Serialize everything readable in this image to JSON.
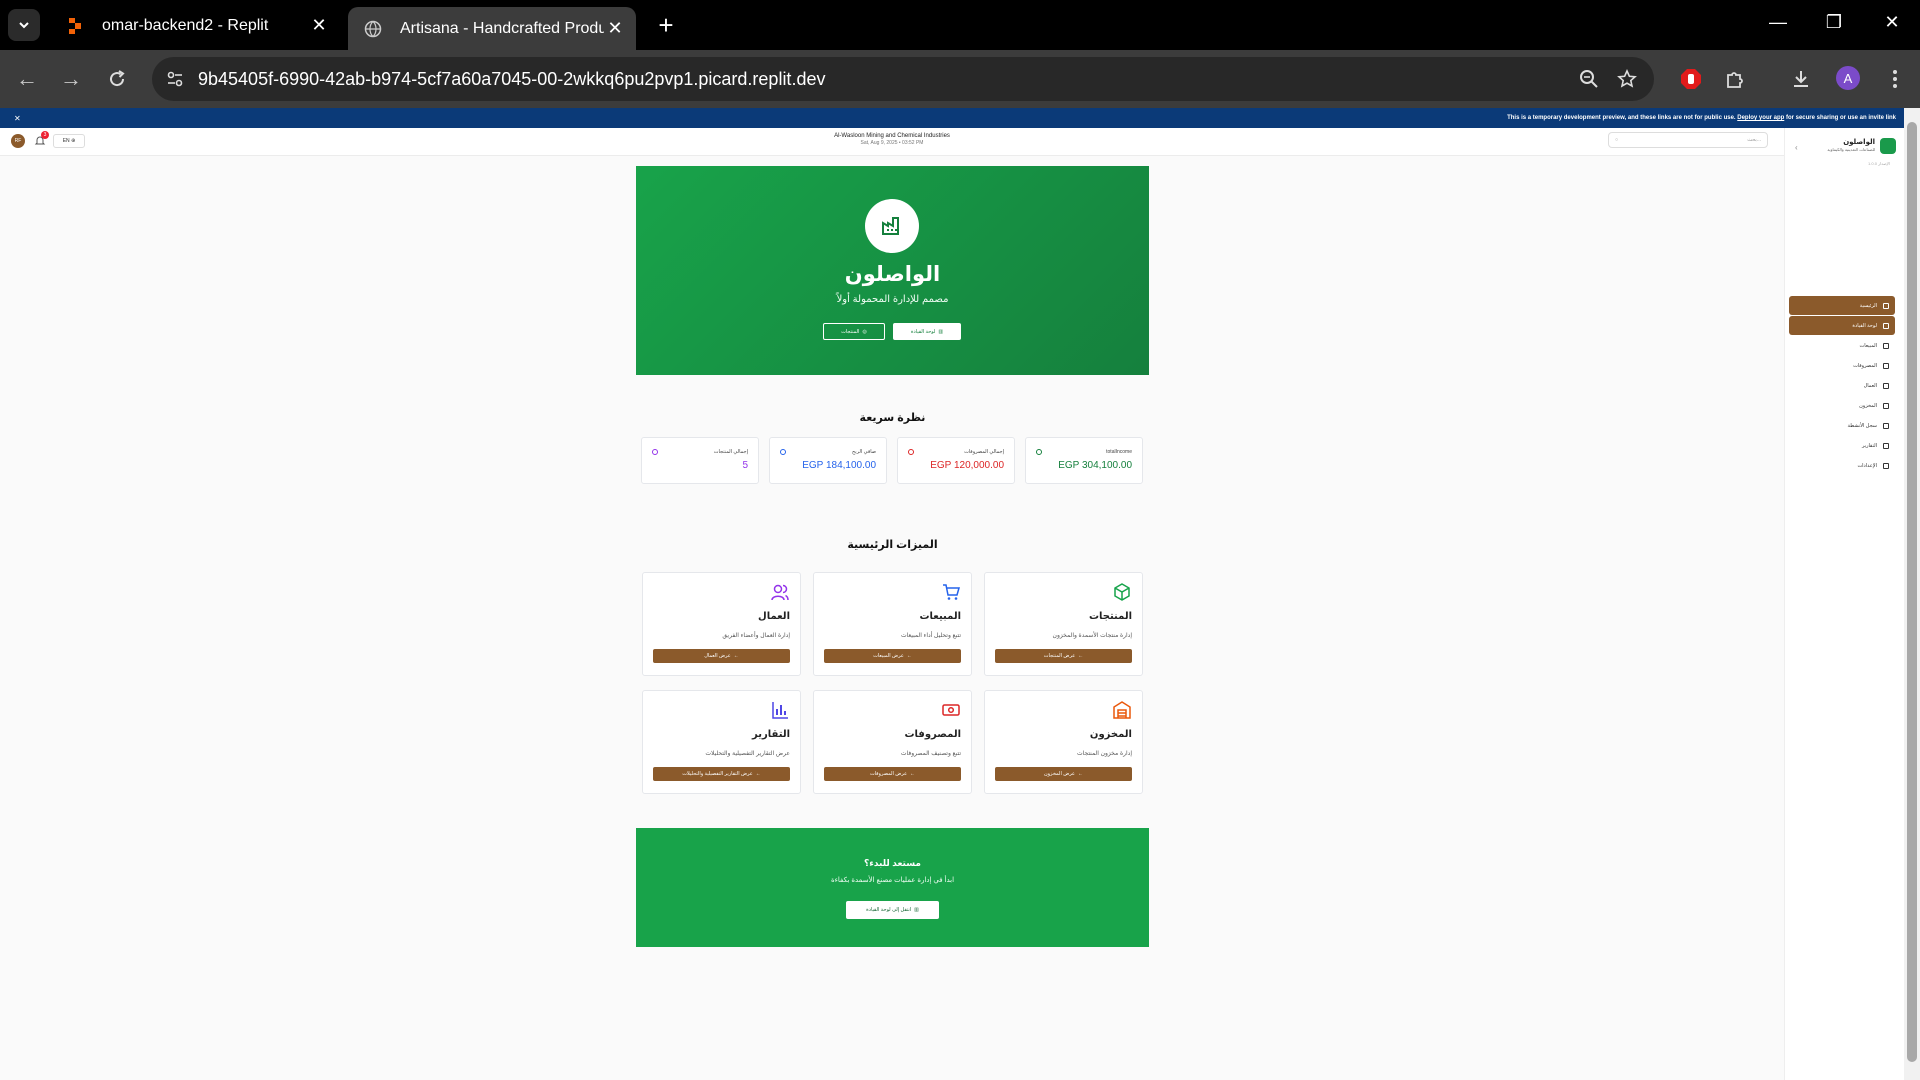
{
  "browser": {
    "tabs": [
      {
        "title": "omar-backend2 - Replit",
        "active": false
      },
      {
        "title": "Artisana - Handcrafted Products",
        "active": true
      }
    ],
    "url": "9b45405f-6990-42ab-b974-5cf7a60a7045-00-2wkkq6pu2pvp1.picard.replit.dev",
    "profile_initial": "A"
  },
  "dev_banner": {
    "text": "This is a temporary development preview, and these links are not for public use.",
    "link": "Deploy your app",
    "suffix": "for secure sharing or use an invite link"
  },
  "header": {
    "company": "Al-Wasloon Mining and Chemical Industries",
    "date": "Sat, Aug 9, 2025 • 03:52 PM",
    "lang": "EN",
    "search_placeholder": "بحث...",
    "user_initials": "RF",
    "notification_count": "3"
  },
  "sidebar": {
    "brand": "الواصلون",
    "brand_sub": "للصناعات التعدينية والكيماوية",
    "version": "الإصدار 1.0.0",
    "items": [
      {
        "label": "الرئيسية",
        "active": true
      },
      {
        "label": "لوحة القيادة",
        "active": true
      },
      {
        "label": "المبيعات",
        "active": false
      },
      {
        "label": "المصروفات",
        "active": false
      },
      {
        "label": "العمال",
        "active": false
      },
      {
        "label": "المخزون",
        "active": false
      },
      {
        "label": "سجل الأنشطة",
        "active": false
      },
      {
        "label": "التقارير",
        "active": false
      },
      {
        "label": "الإعدادات",
        "active": false
      }
    ]
  },
  "hero": {
    "title": "الواصلون",
    "subtitle": "مصمم للإدارة المحمولة أولاً",
    "btn_products": "المنتجات",
    "btn_dashboard": "لوحة القيادة"
  },
  "overview": {
    "title": "نظرة سريعة",
    "stats": [
      {
        "label": "totalIncome",
        "value": "EGP 304,100.00",
        "color": "#15803d"
      },
      {
        "label": "إجمالي المصروفات",
        "value": "EGP 120,000.00",
        "color": "#dc2626"
      },
      {
        "label": "صافي الربح",
        "value": "EGP 184,100.00",
        "color": "#2563eb"
      },
      {
        "label": "إجمالي المنتجات",
        "value": "5",
        "color": "#9333ea"
      }
    ]
  },
  "features": {
    "title": "الميزات الرئيسية",
    "cards": [
      {
        "title": "المنتجات",
        "desc": "إدارة منتجات الأسمدة والمخزون",
        "btn": "عرض المنتجات",
        "icon": "package-icon",
        "color": "#16a34a"
      },
      {
        "title": "المبيعات",
        "desc": "تتبع وتحليل أداء المبيعات",
        "btn": "عرض المبيعات",
        "icon": "cart-icon",
        "color": "#2563eb"
      },
      {
        "title": "العمال",
        "desc": "إدارة العمال وأعضاء الفريق",
        "btn": "عرض العمال",
        "icon": "users-icon",
        "color": "#9333ea"
      },
      {
        "title": "المخزون",
        "desc": "إدارة مخزون المنتجات",
        "btn": "عرض المخزون",
        "icon": "warehouse-icon",
        "color": "#ea580c"
      },
      {
        "title": "المصروفات",
        "desc": "تتبع وتصنيف المصروفات",
        "btn": "عرض المصروفات",
        "icon": "banknote-icon",
        "color": "#dc2626"
      },
      {
        "title": "التقارير",
        "desc": "عرض التقارير التفصيلية والتحليلات",
        "btn": "عرض التقارير التفصيلية والتحليلات",
        "icon": "bar-chart-icon",
        "color": "#4f46e5"
      }
    ]
  },
  "cta": {
    "title": "مستعد للبدء؟",
    "subtitle": "ابدأ في إدارة عمليات مصنع الأسمدة بكفاءة",
    "button": "انتقل إلى لوحة القيادة"
  }
}
